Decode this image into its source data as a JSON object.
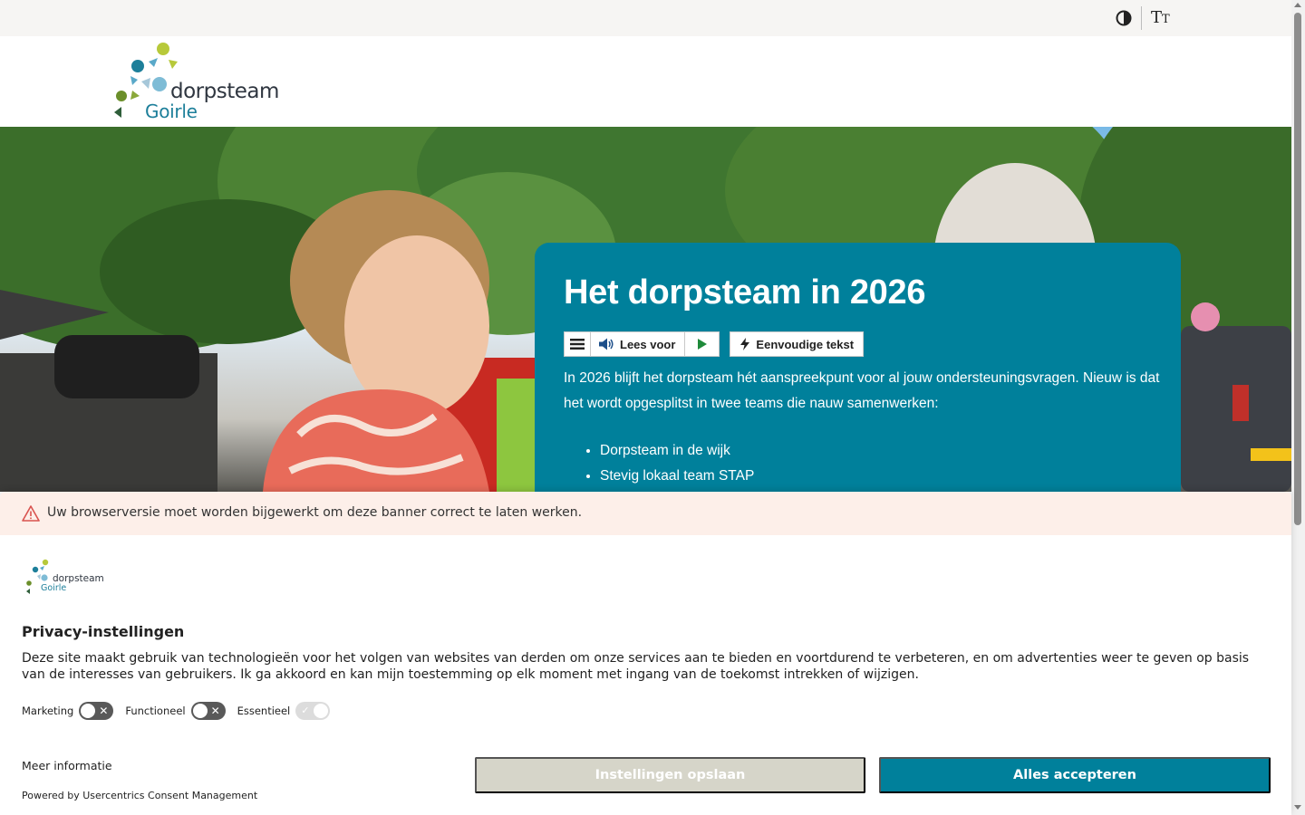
{
  "utility": {
    "contrast_icon": "contrast-icon",
    "textsize_label_big": "T",
    "textsize_label_small": "T"
  },
  "header": {
    "logo_word1": "dorpsteam",
    "logo_word2": "Goirle"
  },
  "hero": {
    "title": "Het dorpsteam in 2026",
    "readspeaker": {
      "listen_label": "Lees voor",
      "simple_label": "Eenvoudige tekst"
    },
    "intro": "In 2026 blijft het dorpsteam hét aanspreekpunt voor al jouw ondersteuningsvragen. Nieuw is dat het wordt opgesplitst in twee teams die nauw samenwerken:",
    "list": [
      "Dorpsteam in de wijk",
      "Stevig lokaal team STAP"
    ]
  },
  "consent": {
    "warning": "Uw browserversie moet worden bijgewerkt om deze banner correct te laten werken.",
    "logo_word1": "dorpsteam",
    "logo_word2": "Goirle",
    "title": "Privacy-instellingen",
    "body": "Deze site maakt gebruik van technologieën voor het volgen van websites van derden om onze services aan te bieden en voortdurend te verbeteren, en om advertenties weer te geven op basis van de interesses van gebruikers. Ik ga akkoord en kan mijn toestemming op elk moment met ingang van de toekomst intrekken of wijzigen.",
    "toggles": [
      {
        "label": "Marketing",
        "state": "off"
      },
      {
        "label": "Functioneel",
        "state": "off"
      },
      {
        "label": "Essentieel",
        "state": "disabled-on"
      }
    ],
    "more_info": "Meer informatie",
    "powered_by": "Powered by Usercentrics Consent Management",
    "save_label": "Instellingen opslaan",
    "accept_label": "Alles accepteren"
  },
  "colors": {
    "brand_teal": "#00809b",
    "save_button": "#d6d5c9",
    "warning_bg": "#fdefe9"
  }
}
